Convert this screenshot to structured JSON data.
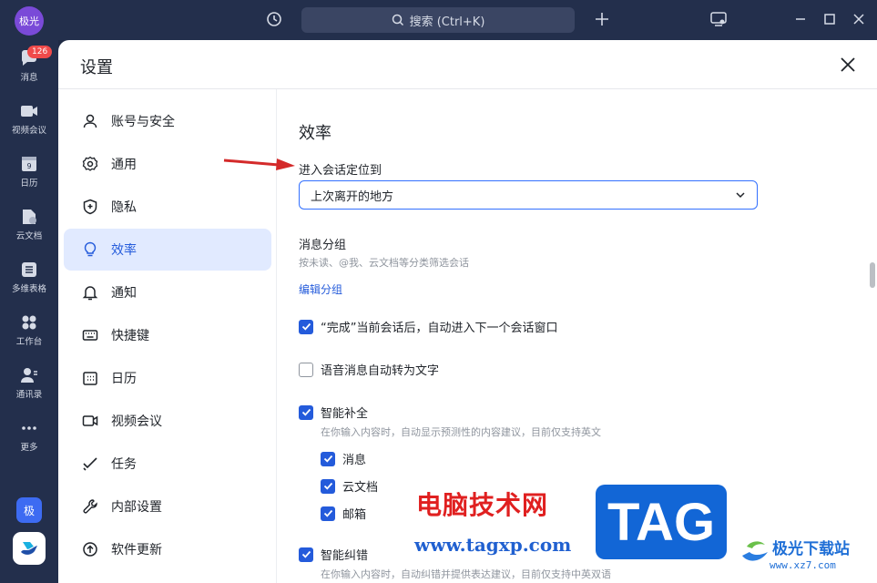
{
  "titlebar": {
    "avatar_text": "极光",
    "search_placeholder": "搜索 (Ctrl+K)"
  },
  "rail": {
    "items": [
      {
        "label": "消息",
        "icon": "chat-bubble-icon",
        "badge": "126"
      },
      {
        "label": "视频会议",
        "icon": "video-camera-icon"
      },
      {
        "label": "日历",
        "icon": "calendar-icon",
        "date": "9"
      },
      {
        "label": "云文档",
        "icon": "cloud-doc-icon"
      },
      {
        "label": "多维表格",
        "icon": "base-table-icon"
      },
      {
        "label": "工作台",
        "icon": "workplace-grid-icon"
      },
      {
        "label": "通讯录",
        "icon": "contacts-icon"
      },
      {
        "label": "更多",
        "icon": "more-dots-icon"
      }
    ],
    "bottom_badge": "极"
  },
  "dialog": {
    "title": "设置"
  },
  "nav": {
    "items": [
      {
        "label": "账号与安全",
        "icon": "user-icon"
      },
      {
        "label": "通用",
        "icon": "gear-icon"
      },
      {
        "label": "隐私",
        "icon": "shield-icon"
      },
      {
        "label": "效率",
        "icon": "lightbulb-icon",
        "active": true
      },
      {
        "label": "通知",
        "icon": "bell-icon"
      },
      {
        "label": "快捷键",
        "icon": "keyboard-icon"
      },
      {
        "label": "日历",
        "icon": "calendar-icon"
      },
      {
        "label": "视频会议",
        "icon": "video-camera-icon"
      },
      {
        "label": "任务",
        "icon": "task-check-icon"
      },
      {
        "label": "内部设置",
        "icon": "wrench-icon"
      },
      {
        "label": "软件更新",
        "icon": "upload-circle-icon"
      }
    ]
  },
  "content": {
    "section_title": "效率",
    "enter_chat_label": "进入会话定位到",
    "enter_chat_value": "上次离开的地方",
    "group_title": "消息分组",
    "group_desc": "按未读、@我、云文档等分类筛选会话",
    "edit_group_link": "编辑分组",
    "options": [
      {
        "label": "“完成”当前会话后，自动进入下一个会话窗口",
        "checked": true
      },
      {
        "label": "语音消息自动转为文字",
        "checked": false
      },
      {
        "label": "智能补全",
        "checked": true,
        "desc": "在你输入内容时，自动显示预测性的内容建议，目前仅支持英文"
      },
      {
        "label": "消息",
        "checked": true
      },
      {
        "label": "云文档",
        "checked": true
      },
      {
        "label": "邮箱",
        "checked": true
      },
      {
        "label": "智能纠错",
        "checked": true,
        "desc": "在你输入内容时，自动纠错并提供表达建议，目前仅支持中英双语"
      }
    ]
  },
  "watermark": {
    "cn_text": "电脑技术网",
    "url": "www.tagxp.com",
    "tag": "TAG",
    "site_name": "极光下载站",
    "site_url": "www.xz7.com"
  },
  "colors": {
    "accent": "#245bdb",
    "active_bg": "#e1eaff",
    "rail_bg": "#232f4c"
  }
}
